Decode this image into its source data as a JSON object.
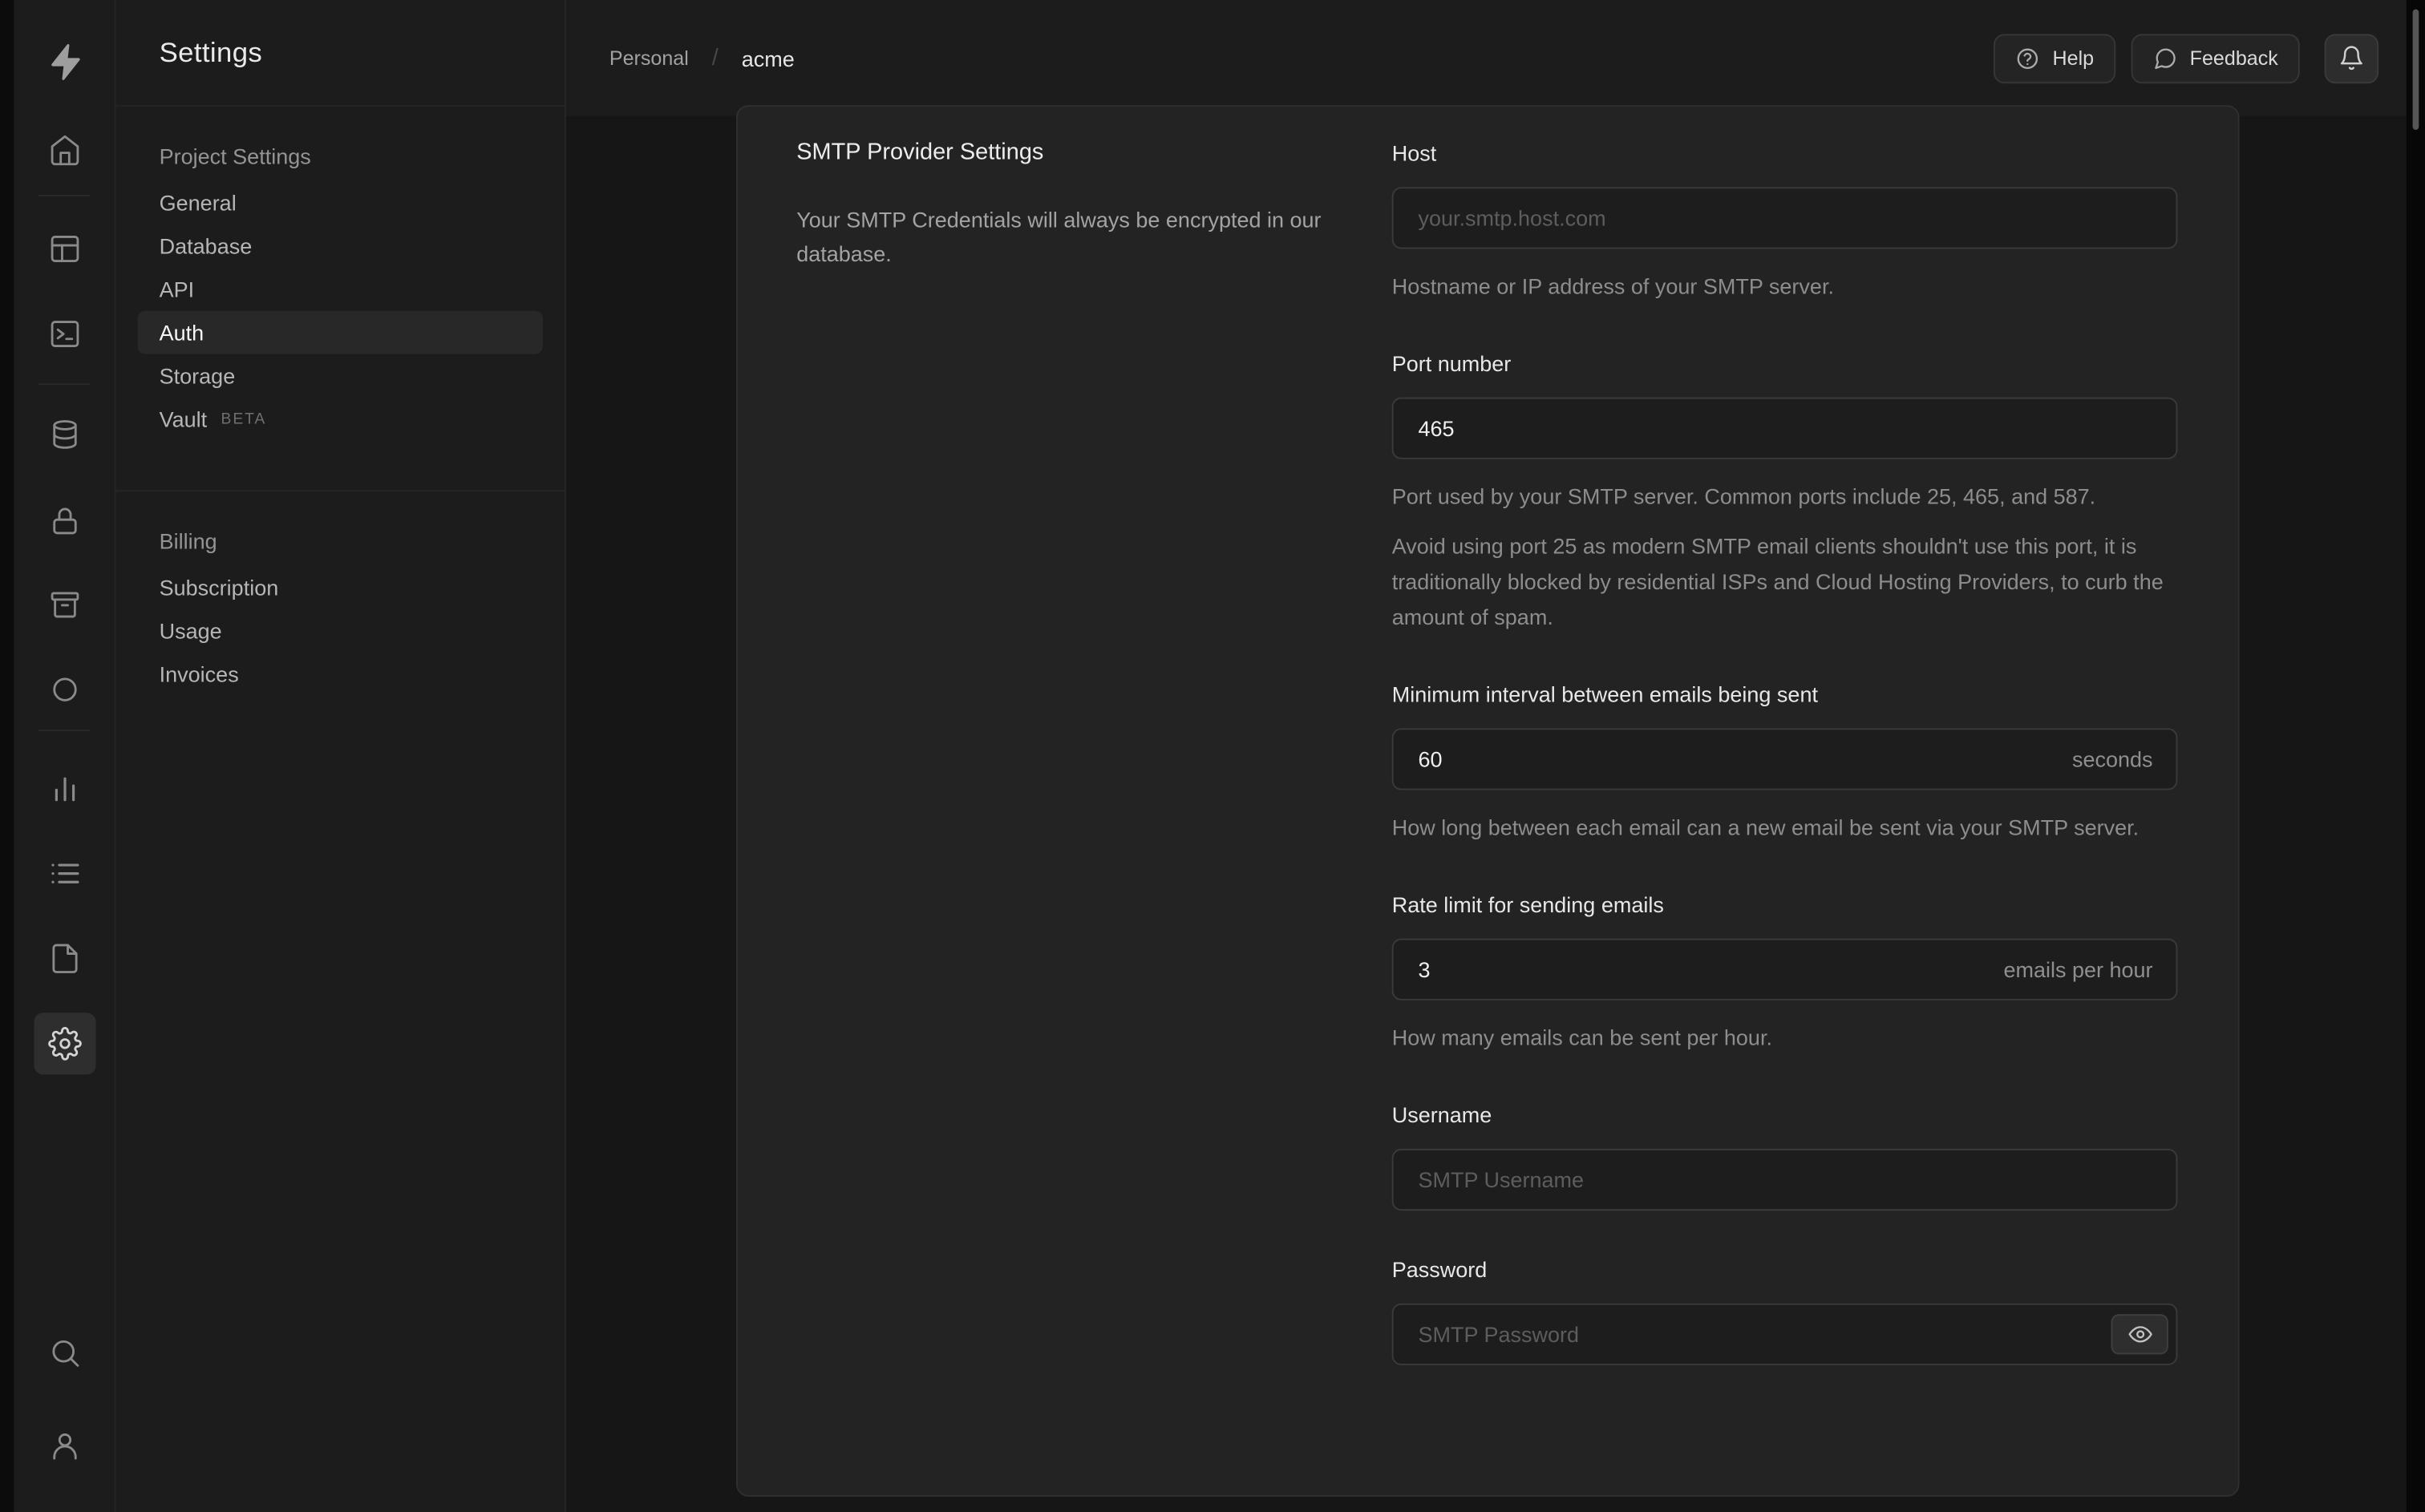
{
  "theme": {
    "background": "#161616",
    "surface": "#1c1c1c",
    "panel": "#232323",
    "border": "#2e2e2e",
    "text_primary": "#ededed",
    "text_secondary": "#8d8d8d"
  },
  "icons": {
    "rail": [
      "supabase-logo",
      "home",
      "table-editor",
      "sql-editor",
      "database",
      "auth",
      "storage",
      "edge-functions",
      "reports",
      "logs",
      "docs",
      "settings",
      "search",
      "user"
    ],
    "header": [
      "help-circle",
      "speech-bubble",
      "bell"
    ],
    "password_field": [
      "eye"
    ]
  },
  "header": {
    "breadcrumb": {
      "org": "Personal",
      "separator": "/",
      "project": "acme"
    },
    "help_label": "Help",
    "feedback_label": "Feedback"
  },
  "sidebar": {
    "title": "Settings",
    "sections": [
      {
        "heading": "Project Settings",
        "items": [
          {
            "label": "General"
          },
          {
            "label": "Database"
          },
          {
            "label": "API"
          },
          {
            "label": "Auth",
            "active": true
          },
          {
            "label": "Storage"
          },
          {
            "label": "Vault",
            "badge": "BETA"
          }
        ]
      },
      {
        "heading": "Billing",
        "items": [
          {
            "label": "Subscription"
          },
          {
            "label": "Usage"
          },
          {
            "label": "Invoices"
          }
        ]
      }
    ]
  },
  "main": {
    "section_title": "SMTP Provider Settings",
    "section_description": "Your SMTP Credentials will always be encrypted in our database.",
    "fields": {
      "host": {
        "label": "Host",
        "placeholder": "your.smtp.host.com",
        "help": "Hostname or IP address of your SMTP server."
      },
      "port": {
        "label": "Port number",
        "value": "465",
        "help": "Port used by your SMTP server. Common ports include 25, 465, and 587.",
        "note": "Avoid using port 25 as modern SMTP email clients shouldn't use this port, it is traditionally blocked by residential ISPs and Cloud Hosting Providers, to curb the amount of spam."
      },
      "interval": {
        "label": "Minimum interval between emails being sent",
        "value": "60",
        "suffix": "seconds",
        "help": "How long between each email can a new email be sent via your SMTP server."
      },
      "rate": {
        "label": "Rate limit for sending emails",
        "value": "3",
        "suffix": "emails per hour",
        "help": "How many emails can be sent per hour."
      },
      "username": {
        "label": "Username",
        "placeholder": "SMTP Username"
      },
      "password": {
        "label": "Password",
        "placeholder": "SMTP Password"
      }
    }
  }
}
